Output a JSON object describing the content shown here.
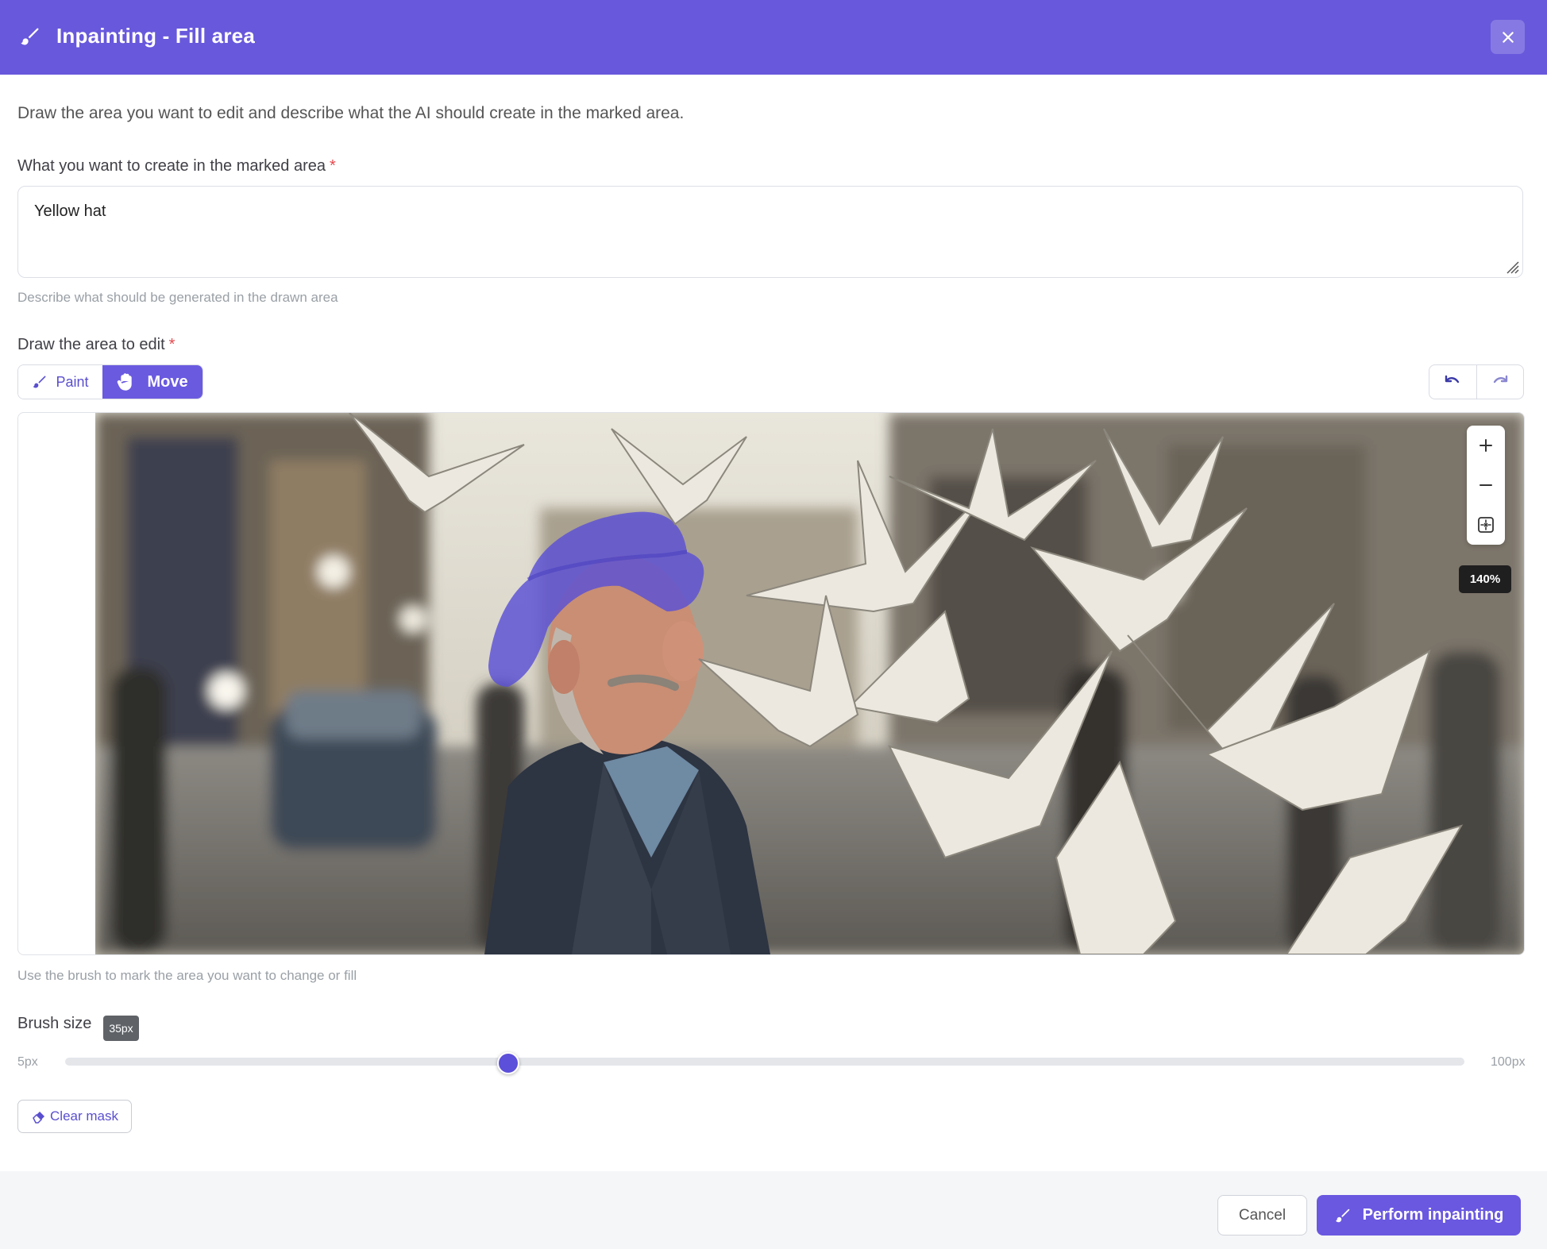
{
  "header": {
    "title": "Inpainting - Fill area",
    "icon": "brush-icon",
    "close_icon": "close-icon",
    "bg_color": "#6858dc"
  },
  "intro": "Draw the area you want to edit and describe what the AI should create in the marked area.",
  "prompt": {
    "label": "What you want to create in the marked area",
    "required_mark": "*",
    "value": "Yellow hat",
    "hint": "Describe what should be generated in the drawn area"
  },
  "draw": {
    "label": "Draw the area to edit",
    "required_mark": "*",
    "modes": [
      {
        "label": "Paint",
        "icon": "brush-icon",
        "active": false
      },
      {
        "label": "Move",
        "icon": "hand-icon",
        "active": true
      }
    ],
    "undo_icon": "undo-icon",
    "redo_icon": "redo-icon",
    "zoom_in_icon": "plus-icon",
    "zoom_out_icon": "minus-icon",
    "fit_icon": "fit-screen-icon",
    "zoom_level": "140%",
    "hint": "Use the brush to mark the area you want to change or fill"
  },
  "brush": {
    "label": "Brush size",
    "value_badge": "35px",
    "min_label": "5px",
    "max_label": "100px",
    "min": 5,
    "max": 100,
    "value": 35
  },
  "clear_mask": {
    "label": "Clear mask",
    "icon": "eraser-icon"
  },
  "footer": {
    "cancel_label": "Cancel",
    "perform_label": "Perform inpainting",
    "perform_icon": "brush-icon",
    "accent_color": "#6a58e0"
  }
}
